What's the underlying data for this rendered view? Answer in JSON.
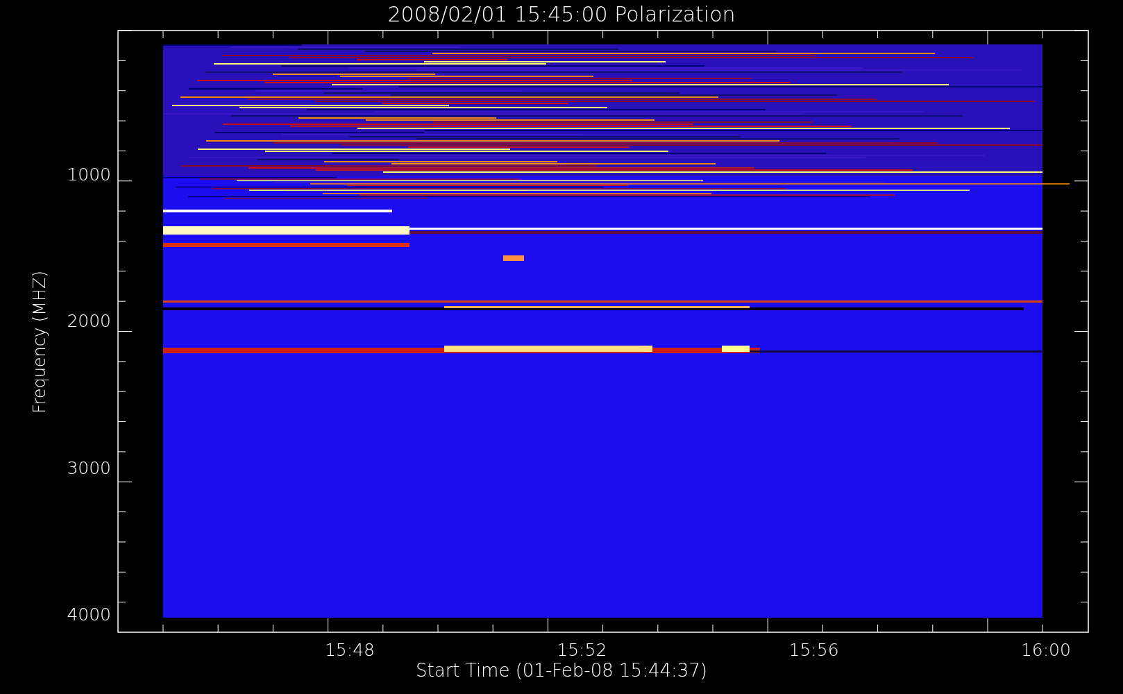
{
  "title": "2008/02/01 15:45:00 Polarization",
  "y_axis": {
    "label": "Frequency (MHZ)",
    "ticks": [
      "1000",
      "2000",
      "3000",
      "4000"
    ]
  },
  "x_axis": {
    "label": "Start Time (01-Feb-08 15:44:37)",
    "ticks": [
      "15:48",
      "15:52",
      "15:56",
      "16:00"
    ]
  }
}
